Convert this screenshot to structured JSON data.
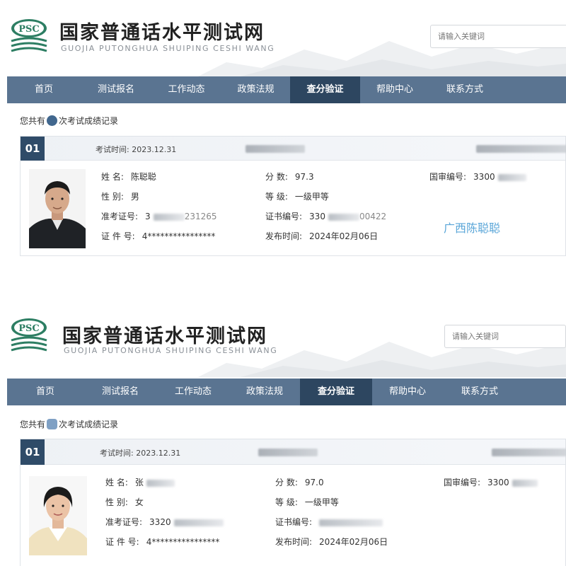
{
  "site": {
    "logo_text": "PSC",
    "title": "国家普通话水平测试网",
    "subtitle": "GUOJIA PUTONGHUA SHUIPING CESHI WANG",
    "search_placeholder": "请输入关键词"
  },
  "nav": {
    "home": "首页",
    "register": "测试报名",
    "news": "工作动态",
    "policy": "政策法规",
    "score_query": "查分验证",
    "help": "帮助中心",
    "contact": "联系方式",
    "active": "查分验证"
  },
  "colors": {
    "nav_bg": "#5a7491",
    "nav_active": "#2d4660",
    "accent": "#2f4b68",
    "stamp": "#5aa6d8"
  },
  "records": [
    {
      "count_prefix": "您共有",
      "count_suffix": "次考试成绩记录",
      "index": "01",
      "exam_time_label": "考试时间:",
      "exam_time": "2023.12.31",
      "name_label": "姓  名:",
      "name": "陈聪聪",
      "gender_label": "性  别:",
      "gender": "男",
      "ticket_label": "准考证号:",
      "ticket_visible": "3",
      "ticket_tail": "231265",
      "id_label": "证 件 号:",
      "id_value": "4****************",
      "score_label": "分  数:",
      "score": "97.3",
      "level_label": "等  级:",
      "level": "一级甲等",
      "cert_label": "证书编号:",
      "cert_prefix": "330",
      "cert_tail": "00422",
      "publish_label": "发布时间:",
      "publish_date": "2024年02月06日",
      "national_label": "国审编号:",
      "national_value": "3300",
      "watermark": "广西陈聪聪"
    },
    {
      "count_prefix": "您共有",
      "count_suffix": "次考试成绩记录",
      "index": "01",
      "exam_time_label": "考试时间:",
      "exam_time": "2023.12.31",
      "name_label": "姓  名:",
      "name": "张",
      "gender_label": "性  别:",
      "gender": "女",
      "ticket_label": "准考证号:",
      "ticket_visible": "3320",
      "ticket_tail": "",
      "id_label": "证 件 号:",
      "id_value": "4****************",
      "score_label": "分  数:",
      "score": "97.0",
      "level_label": "等  级:",
      "level": "一级甲等",
      "cert_label": "证书编号:",
      "cert_prefix": "",
      "cert_tail": "",
      "publish_label": "发布时间:",
      "publish_date": "2024年02月06日",
      "national_label": "国审编号:",
      "national_value": "3300",
      "watermark": ""
    }
  ]
}
